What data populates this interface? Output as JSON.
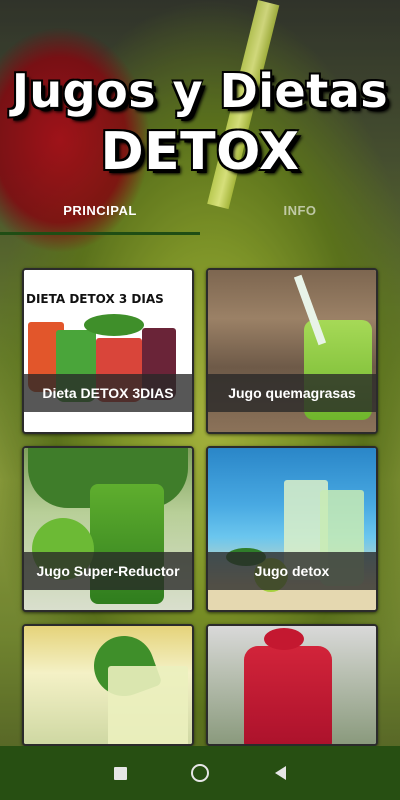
{
  "header": {
    "title_line1": "Jugos y Dietas",
    "title_line2": "DETOX"
  },
  "tabs": [
    {
      "label": "PRINCIPAL",
      "active": true
    },
    {
      "label": "INFO",
      "active": false
    }
  ],
  "cards": [
    {
      "label": "Dieta DETOX 3DIAS",
      "image_text": "DIETA DETOX 3 DIAS"
    },
    {
      "label": "Jugo quemagrasas"
    },
    {
      "label": "Jugo Super-Reductor"
    },
    {
      "label": "Jugo detox"
    },
    {
      "label": ""
    },
    {
      "label": ""
    }
  ],
  "colors": {
    "accent": "#274f12",
    "tab_active": "#ffffff",
    "card_label_bg": "#282828"
  },
  "navbar": {
    "buttons": [
      "recent-apps-icon",
      "home-icon",
      "back-icon"
    ]
  }
}
